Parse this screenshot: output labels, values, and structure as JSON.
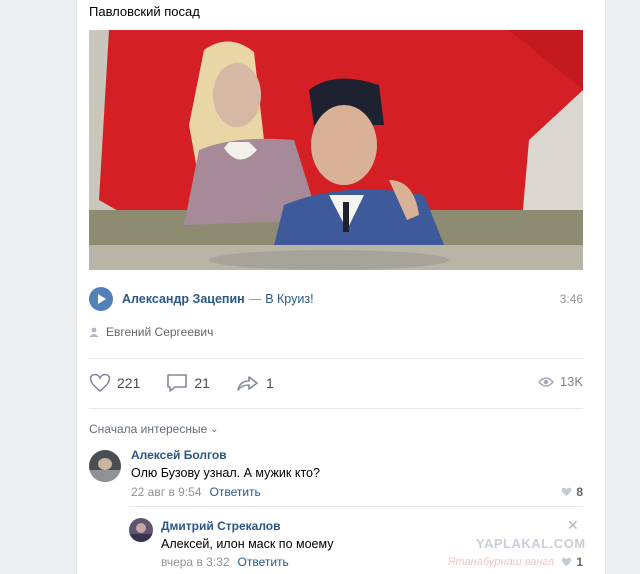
{
  "post": {
    "caption": "Павловский посад",
    "audio": {
      "artist": "Александр Зацепин",
      "separator": "—",
      "title": "В Круиз!",
      "duration": "3:46"
    },
    "author": "Евгений Сергеевич",
    "actions": {
      "likes": "221",
      "comments": "21",
      "shares": "1",
      "views": "13K"
    }
  },
  "comments": {
    "sort_label": "Сначала интересные",
    "items": [
      {
        "name": "Алексей Болгов",
        "text": "Олю Бузову узнал. А мужик кто?",
        "date": "22 авг в 9:54",
        "reply": "Ответить",
        "likes": "8"
      },
      {
        "name": "Дмитрий Стрекалов",
        "text": "Алексей, илон маск по моему",
        "date": "вчера в 3:32",
        "reply": "Ответить",
        "likes": "1"
      }
    ]
  },
  "watermark": {
    "site": "YAPLAKAL.COM",
    "handwritten": "Ятанабурнаш вангл"
  },
  "colors": {
    "link": "#2a5885",
    "accent": "#5181b8",
    "mural_red": "#d41f24"
  }
}
